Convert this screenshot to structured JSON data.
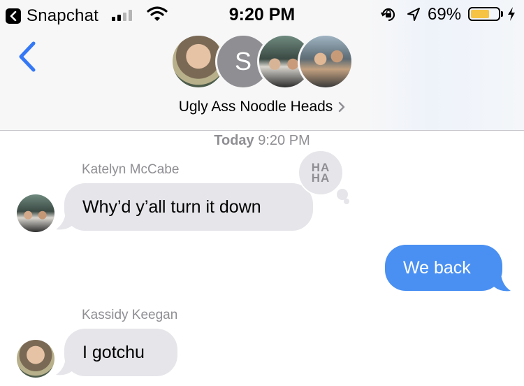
{
  "status_bar": {
    "back_app": "Snapchat",
    "time": "9:20 PM",
    "battery": "69%",
    "battery_level": 0.69,
    "icons": [
      "back-arrow-icon",
      "signal-icon",
      "wifi-icon",
      "rotation-lock-icon",
      "location-arrow-icon",
      "battery-icon",
      "charging-bolt-icon"
    ]
  },
  "header": {
    "back_icon": "chevron-left-icon",
    "group_name": "Ugly Ass Noodle Heads",
    "detail_icon": "chevron-right-icon",
    "avatars": [
      {
        "type": "photo"
      },
      {
        "type": "initial",
        "initial": "S"
      },
      {
        "type": "photo"
      },
      {
        "type": "photo"
      }
    ]
  },
  "conversation": {
    "timestamp_day": "Today",
    "timestamp_time": "9:20 PM",
    "messages": [
      {
        "sender": "Katelyn McCabe",
        "text": "Why’d y’all turn it down",
        "direction": "incoming",
        "reaction": "HA HA"
      },
      {
        "sender": "",
        "text": "We back",
        "direction": "outgoing"
      },
      {
        "sender": "Kassidy Keegan",
        "text": "I gotchu",
        "direction": "incoming"
      }
    ]
  },
  "reaction": {
    "line1": "HA",
    "line2": "HA"
  },
  "colors": {
    "accent": "#3478f6",
    "outgoing_bubble": "#4a90f2",
    "incoming_bubble": "#e5e5ea",
    "battery_fill": "#f6c343",
    "secondary_text": "#8e8e93"
  }
}
